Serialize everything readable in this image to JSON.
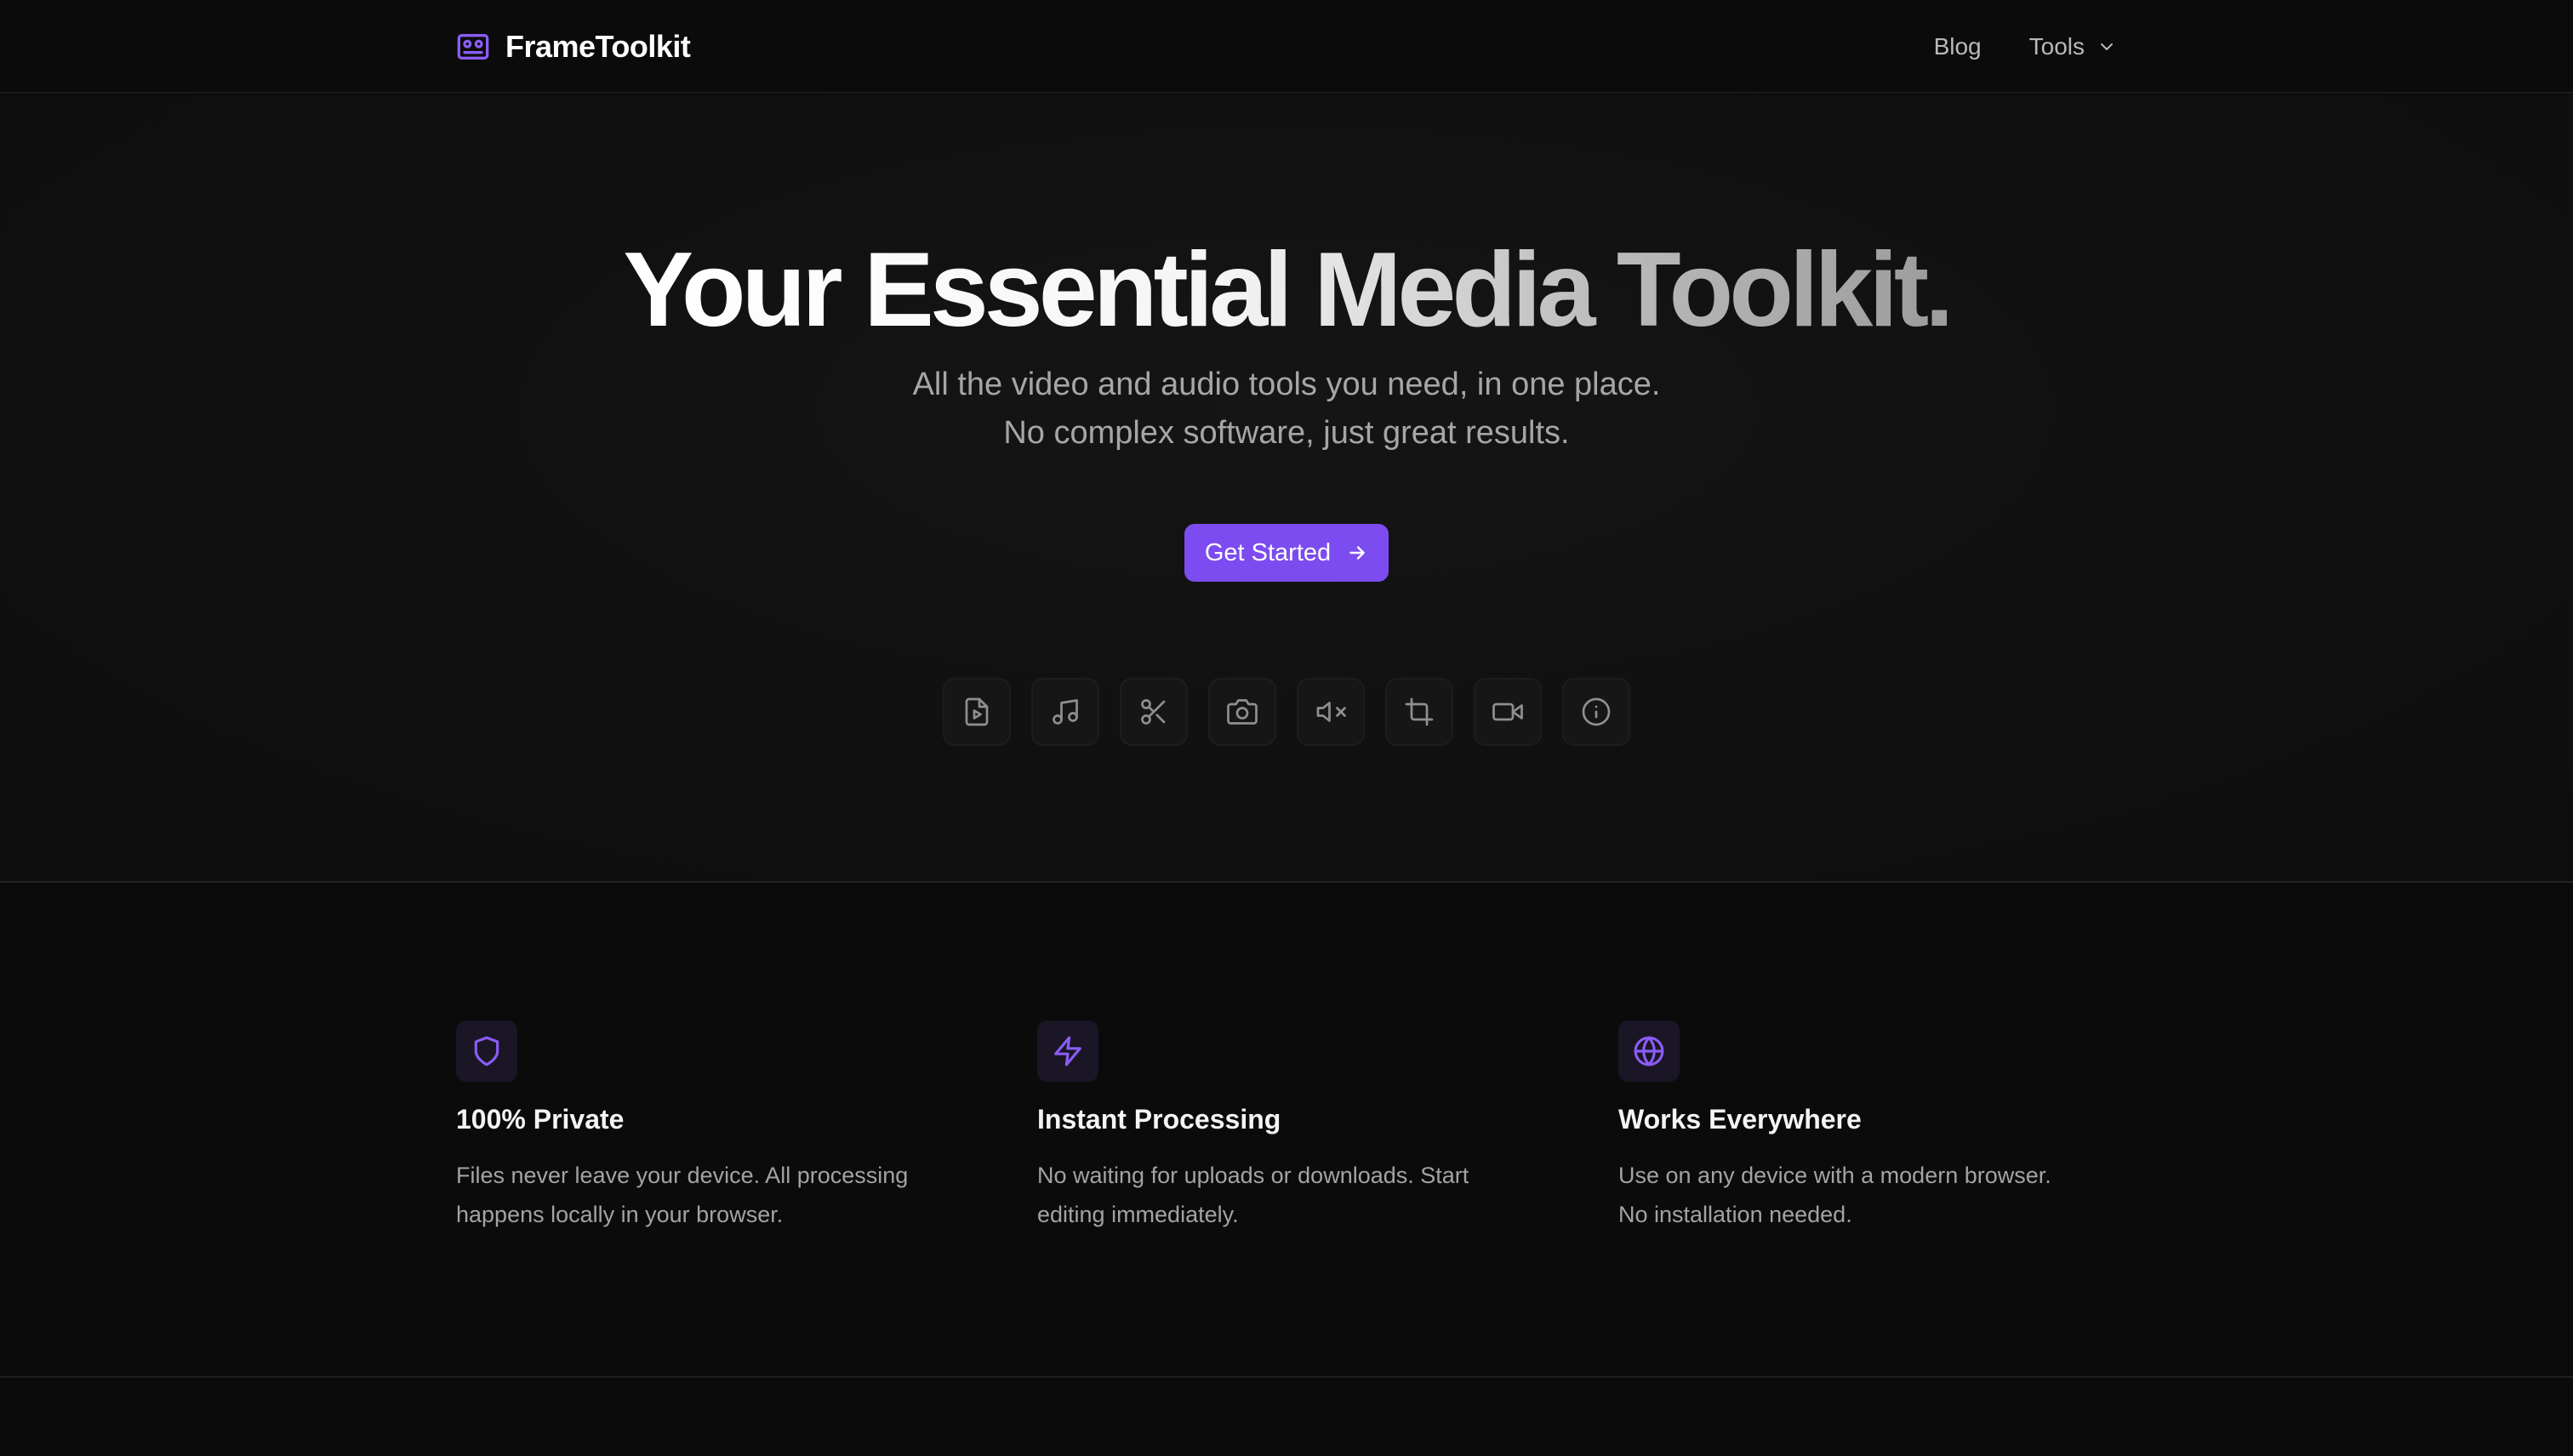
{
  "header": {
    "brand_name": "FrameToolkit",
    "brand_icon": "film-reel-icon",
    "nav": {
      "blog_label": "Blog",
      "tools_label": "Tools"
    }
  },
  "hero": {
    "title": "Your Essential Media Toolkit.",
    "subtitle_line1": "All the video and audio tools you need, in one place.",
    "subtitle_line2": "No complex software, just great results.",
    "cta_label": "Get Started",
    "tool_icons": [
      "video-file-icon",
      "music-note-icon",
      "scissors-icon",
      "camera-icon",
      "mute-icon",
      "crop-icon",
      "video-camera-icon",
      "info-icon"
    ]
  },
  "features": [
    {
      "icon": "shield-icon",
      "title": "100% Private",
      "desc_line1": "Files never leave your device. All processing",
      "desc_line2": "happens locally in your browser."
    },
    {
      "icon": "lightning-icon",
      "title": "Instant Processing",
      "desc_line1": "No waiting for uploads or downloads. Start",
      "desc_line2": "editing immediately."
    },
    {
      "icon": "globe-icon",
      "title": "Works Everywhere",
      "desc_line1": "Use on any device with a modern browser.",
      "desc_line2": "No installation needed."
    }
  ],
  "colors": {
    "background": "#0b0b0b",
    "accent": "#7c4cf0",
    "muted_text": "#a3a3a3"
  }
}
